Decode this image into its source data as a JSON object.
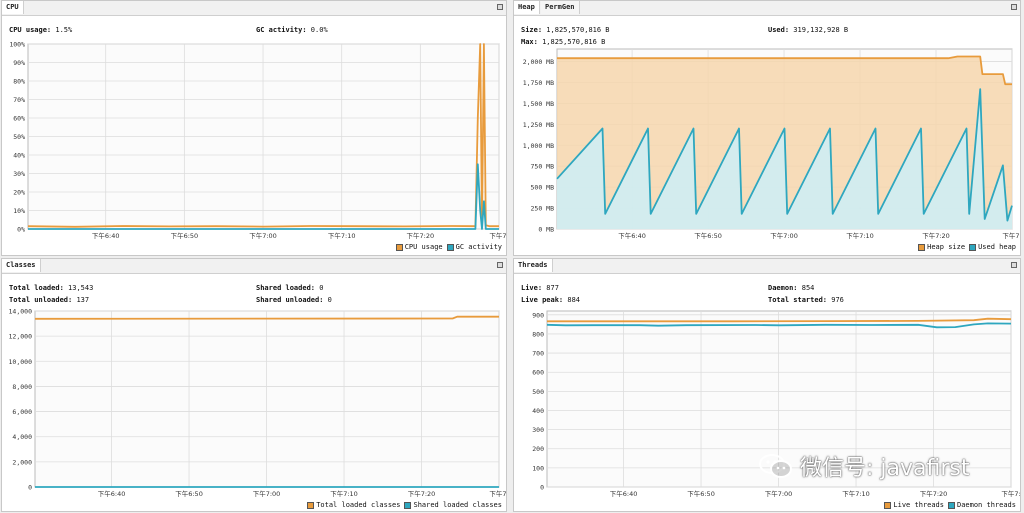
{
  "colors": {
    "orange": "#e89b3c",
    "orange_fill": "#f6d6ad",
    "blue": "#2ea7bf",
    "blue_fill": "#cdeff7",
    "grid": "#dddddd",
    "frame": "#bbbbbb"
  },
  "cpu": {
    "tab": "CPU",
    "cpu_usage_label": "CPU usage:",
    "cpu_usage_value": "1.5%",
    "gc_label": "GC activity:",
    "gc_value": "0.0%",
    "legend": [
      "CPU usage",
      "GC activity"
    ]
  },
  "heap": {
    "tabs": [
      "Heap",
      "PermGen"
    ],
    "size_label": "Size:",
    "size_value": "1,825,570,816 B",
    "used_label": "Used:",
    "used_value": "319,132,928 B",
    "max_label": "Max:",
    "max_value": "1,825,570,816 B",
    "legend": [
      "Heap size",
      "Used heap"
    ]
  },
  "classes": {
    "tab": "Classes",
    "total_loaded_label": "Total loaded:",
    "total_loaded_value": "13,543",
    "total_unloaded_label": "Total unloaded:",
    "total_unloaded_value": "137",
    "shared_loaded_label": "Shared loaded:",
    "shared_loaded_value": "0",
    "shared_unloaded_label": "Shared unloaded:",
    "shared_unloaded_value": "0",
    "legend": [
      "Total loaded classes",
      "Shared loaded classes"
    ]
  },
  "threads": {
    "tab": "Threads",
    "live_label": "Live:",
    "live_value": "877",
    "daemon_label": "Daemon:",
    "daemon_value": "854",
    "peak_label": "Live peak:",
    "peak_value": "884",
    "started_label": "Total started:",
    "started_value": "976",
    "legend": [
      "Live threads",
      "Daemon threads"
    ]
  },
  "watermark": {
    "text": "微信号: javafirst",
    "icon": "wechat-icon"
  },
  "chart_data": [
    {
      "id": "cpu",
      "type": "line",
      "y_ticks": [
        "0%",
        "10%",
        "20%",
        "30%",
        "40%",
        "50%",
        "60%",
        "70%",
        "80%",
        "90%",
        "100%"
      ],
      "x_ticks": [
        "下午6:40",
        "下午6:50",
        "下午7:00",
        "下午7:10",
        "下午7:20",
        "下午7:"
      ],
      "ylim": [
        0,
        100
      ],
      "xlim": [
        0,
        100
      ],
      "series": [
        {
          "name": "CPU usage",
          "color": "orange",
          "points": [
            [
              0,
              1.5
            ],
            [
              10,
              1.2
            ],
            [
              20,
              1.6
            ],
            [
              30,
              1.4
            ],
            [
              40,
              1.5
            ],
            [
              50,
              1.3
            ],
            [
              60,
              1.6
            ],
            [
              70,
              1.5
            ],
            [
              80,
              1.4
            ],
            [
              90,
              1.6
            ],
            [
              95,
              1.5
            ],
            [
              95.5,
              60
            ],
            [
              96,
              100
            ],
            [
              96.4,
              2
            ],
            [
              96.8,
              100
            ],
            [
              97.2,
              2
            ],
            [
              98,
              1.5
            ],
            [
              100,
              1.5
            ]
          ]
        },
        {
          "name": "GC activity",
          "color": "blue",
          "points": [
            [
              0,
              0
            ],
            [
              95,
              0
            ],
            [
              95.5,
              35
            ],
            [
              96,
              10
            ],
            [
              96.4,
              0
            ],
            [
              96.8,
              15
            ],
            [
              97.2,
              0
            ],
            [
              100,
              0
            ]
          ]
        }
      ]
    },
    {
      "id": "heap",
      "type": "area",
      "y_ticks": [
        "0 MB",
        "250 MB",
        "500 MB",
        "750 MB",
        "1,000 MB",
        "1,250 MB",
        "1,500 MB",
        "1,750 MB",
        "2,000 MB"
      ],
      "x_ticks": [
        "下午6:40",
        "下午6:50",
        "下午7:00",
        "下午7:10",
        "下午7:20",
        "下午7:"
      ],
      "ylim": [
        0,
        2150
      ],
      "xlim": [
        0,
        100
      ],
      "series": [
        {
          "name": "Heap size",
          "color": "orange",
          "points": [
            [
              0,
              2040
            ],
            [
              86,
              2040
            ],
            [
              88,
              2060
            ],
            [
              93,
              2060
            ],
            [
              93.5,
              1850
            ],
            [
              98,
              1850
            ],
            [
              98.5,
              1730
            ],
            [
              100,
              1730
            ]
          ]
        },
        {
          "name": "Used heap",
          "color": "blue",
          "points": [
            [
              0,
              600
            ],
            [
              10,
              1200
            ],
            [
              10.6,
              180
            ],
            [
              20,
              1200
            ],
            [
              20.6,
              180
            ],
            [
              30,
              1200
            ],
            [
              30.6,
              180
            ],
            [
              40,
              1200
            ],
            [
              40.6,
              180
            ],
            [
              50,
              1200
            ],
            [
              50.6,
              180
            ],
            [
              60,
              1200
            ],
            [
              60.6,
              180
            ],
            [
              70,
              1200
            ],
            [
              70.6,
              180
            ],
            [
              80,
              1200
            ],
            [
              80.6,
              180
            ],
            [
              90,
              1200
            ],
            [
              90.6,
              180
            ],
            [
              93,
              1670
            ],
            [
              94,
              120
            ],
            [
              98,
              760
            ],
            [
              99,
              100
            ],
            [
              100,
              280
            ]
          ]
        }
      ]
    },
    {
      "id": "classes",
      "type": "line",
      "y_ticks": [
        "0",
        "2,000",
        "4,000",
        "6,000",
        "8,000",
        "10,000",
        "12,000",
        "14,000"
      ],
      "x_ticks": [
        "下午6:40",
        "下午6:50",
        "下午7:00",
        "下午7:10",
        "下午7:20",
        "下午7:"
      ],
      "ylim": [
        0,
        14000
      ],
      "xlim": [
        0,
        100
      ],
      "series": [
        {
          "name": "Total loaded classes",
          "color": "orange",
          "points": [
            [
              0,
              13380
            ],
            [
              90,
              13400
            ],
            [
              91,
              13550
            ],
            [
              100,
              13543
            ]
          ]
        },
        {
          "name": "Shared loaded classes",
          "color": "blue",
          "points": [
            [
              0,
              0
            ],
            [
              100,
              0
            ]
          ]
        }
      ]
    },
    {
      "id": "threads",
      "type": "line",
      "y_ticks": [
        "0",
        "100",
        "200",
        "300",
        "400",
        "500",
        "600",
        "700",
        "800",
        "900"
      ],
      "x_ticks": [
        "下午6:40",
        "下午6:50",
        "下午7:00",
        "下午7:10",
        "下午7:20",
        "下午7:"
      ],
      "ylim": [
        0,
        920
      ],
      "xlim": [
        0,
        100
      ],
      "series": [
        {
          "name": "Live threads",
          "color": "orange",
          "points": [
            [
              0,
              866
            ],
            [
              20,
              866
            ],
            [
              40,
              866
            ],
            [
              60,
              867
            ],
            [
              80,
              868
            ],
            [
              92,
              872
            ],
            [
              95,
              880
            ],
            [
              100,
              877
            ]
          ]
        },
        {
          "name": "Daemon threads",
          "color": "blue",
          "points": [
            [
              0,
              848
            ],
            [
              4,
              845
            ],
            [
              10,
              846
            ],
            [
              20,
              846
            ],
            [
              24,
              843
            ],
            [
              30,
              846
            ],
            [
              45,
              847
            ],
            [
              50,
              845
            ],
            [
              60,
              848
            ],
            [
              70,
              847
            ],
            [
              80,
              848
            ],
            [
              84,
              835
            ],
            [
              88,
              836
            ],
            [
              92,
              850
            ],
            [
              95,
              855
            ],
            [
              100,
              854
            ]
          ]
        }
      ]
    }
  ]
}
